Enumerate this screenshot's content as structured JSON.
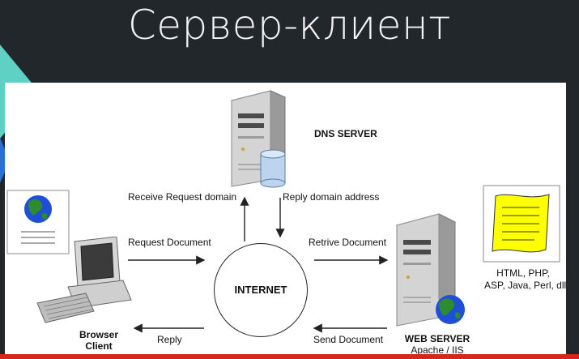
{
  "title": "Сервер-клиент",
  "diagram": {
    "dns_server": "DNS SERVER",
    "internet": "INTERNET",
    "receive_request_domain": "Receive Request domain",
    "reply_domain_address": "Reply domain address",
    "request_document": "Request Document",
    "retrive_document": "Retrive Document",
    "reply": "Reply",
    "send_document": "Send Document",
    "browser_client_line1": "Browser",
    "browser_client_line2": "Client",
    "web_server": "WEB SERVER",
    "web_server_sub": "Apache / IIS",
    "tech_line1": "HTML, PHP,",
    "tech_line2": "ASP, Java, Perl, dll"
  },
  "colors": {
    "background": "#22272b",
    "accent_bar": "#d7261e",
    "document_yellow": "#ffff00",
    "globe_blue": "#1f4fd6",
    "globe_green": "#2e8b2e"
  }
}
